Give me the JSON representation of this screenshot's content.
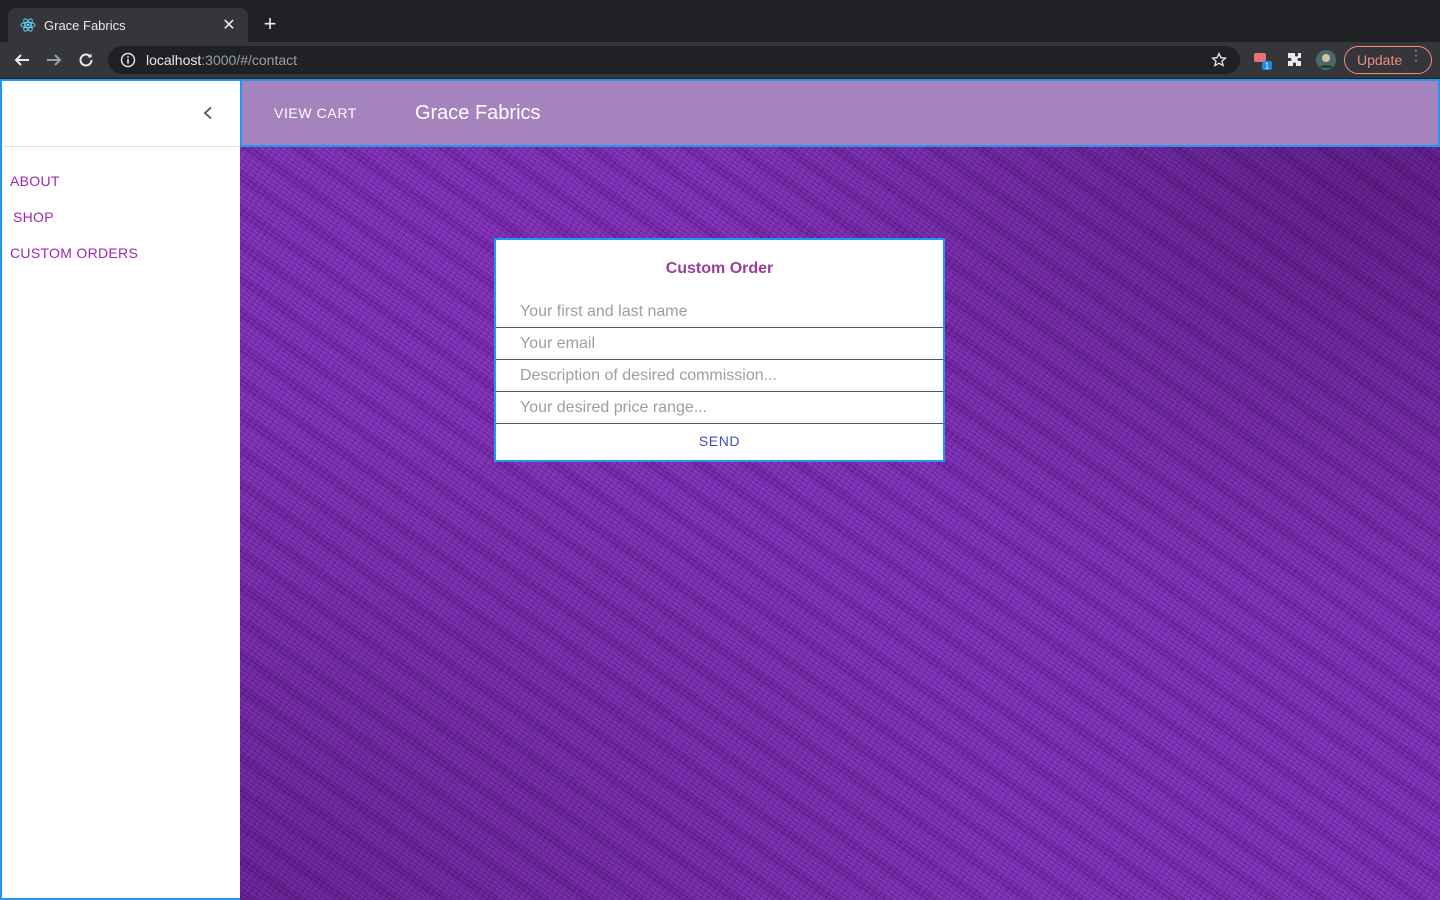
{
  "browser": {
    "tab_title": "Grace Fabrics",
    "url_host": "localhost",
    "url_path": ":3000/#/contact",
    "update_label": "Update",
    "extension_badge": "1"
  },
  "drawer": {
    "items": [
      {
        "label": "ABOUT"
      },
      {
        "label": "SHOP"
      },
      {
        "label": "CUSTOM ORDERS"
      }
    ]
  },
  "appbar": {
    "view_cart_label": "VIEW CART",
    "brand": "Grace Fabrics"
  },
  "form": {
    "title": "Custom Order",
    "name_placeholder": "Your first and last name",
    "email_placeholder": "Your email",
    "description_placeholder": "Description of desired commission...",
    "price_placeholder": "Your desired price range...",
    "send_label": "SEND"
  },
  "colors": {
    "accent_purple": "#9c27b0",
    "appbar_bg": "#a584bd",
    "focus_blue": "#2196f3",
    "send_blue": "#3f51b5"
  }
}
